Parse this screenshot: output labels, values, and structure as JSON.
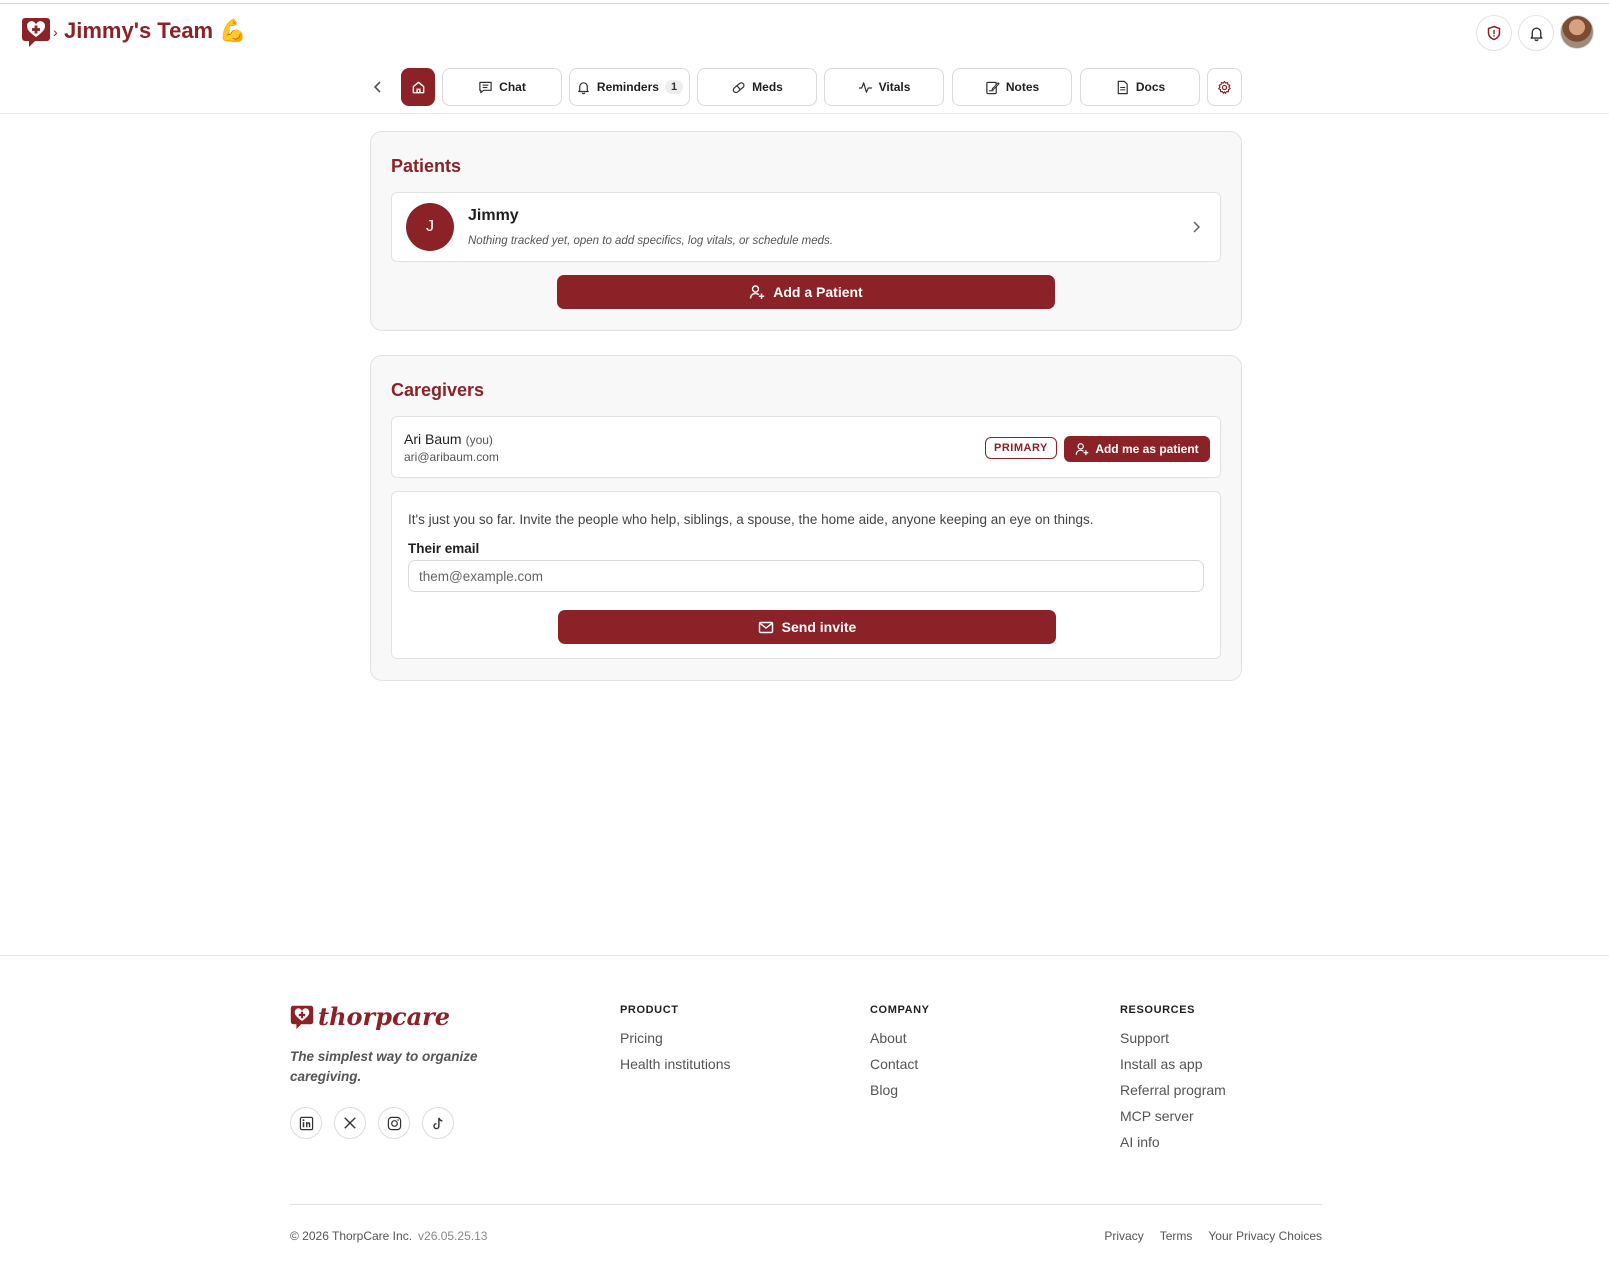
{
  "header": {
    "team_title": "Jimmy's Team 💪",
    "breadcrumb_sep": "›"
  },
  "tabs": {
    "chat": "Chat",
    "reminders": "Reminders",
    "reminders_count": "1",
    "meds": "Meds",
    "vitals": "Vitals",
    "notes": "Notes",
    "docs": "Docs"
  },
  "patients": {
    "title": "Patients",
    "items": [
      {
        "initial": "J",
        "name": "Jimmy",
        "note": "Nothing tracked yet, open to add specifics, log vitals, or schedule meds."
      }
    ],
    "add_button": "Add a Patient"
  },
  "caregivers": {
    "title": "Caregivers",
    "items": [
      {
        "name": "Ari Baum",
        "you_tag": "(you)",
        "email": "ari@aribaum.com",
        "role_badge": "PRIMARY",
        "action": "Add me as patient"
      }
    ],
    "invite": {
      "text": "It's just you so far. Invite the people who help, siblings, a spouse, the home aide, anyone keeping an eye on things.",
      "label": "Their email",
      "placeholder": "them@example.com",
      "button": "Send invite"
    }
  },
  "footer": {
    "brand": "thorpcare",
    "tagline": "The simplest way to organize caregiving.",
    "social": [
      "linkedin-icon",
      "x-icon",
      "instagram-icon",
      "tiktok-icon"
    ],
    "columns": [
      {
        "heading": "PRODUCT",
        "links": [
          "Pricing",
          "Health institutions"
        ]
      },
      {
        "heading": "COMPANY",
        "links": [
          "About",
          "Contact",
          "Blog"
        ]
      },
      {
        "heading": "RESOURCES",
        "links": [
          "Support",
          "Install as app",
          "Referral program",
          "MCP server",
          "AI info"
        ]
      }
    ],
    "copyright": "© 2026 ThorpCare Inc.",
    "version": "v26.05.25.13",
    "legal": [
      "Privacy",
      "Terms",
      "Your Privacy Choices"
    ]
  },
  "colors": {
    "brand": "#8a2227",
    "border": "#e2e2e2",
    "card_bg": "#f8f8f8"
  }
}
